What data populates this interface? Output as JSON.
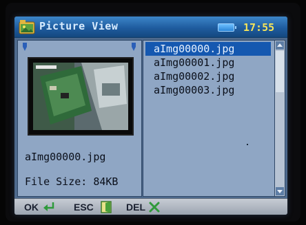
{
  "titlebar": {
    "title": "Picture View",
    "clock": "17:55"
  },
  "preview": {
    "filename": "aImg00000.jpg",
    "file_size": "File Size: 84KB"
  },
  "file_list": {
    "items": [
      "aImg00000.jpg",
      "aImg00001.jpg",
      "aImg00002.jpg",
      "aImg00003.jpg"
    ],
    "selected_index": 0
  },
  "bottombar": {
    "ok_label": "OK",
    "esc_label": "ESC",
    "del_label": "DEL"
  },
  "colors": {
    "accent": "#1558b0",
    "clock": "#f5e45a",
    "panel": "#8fa6c4"
  }
}
